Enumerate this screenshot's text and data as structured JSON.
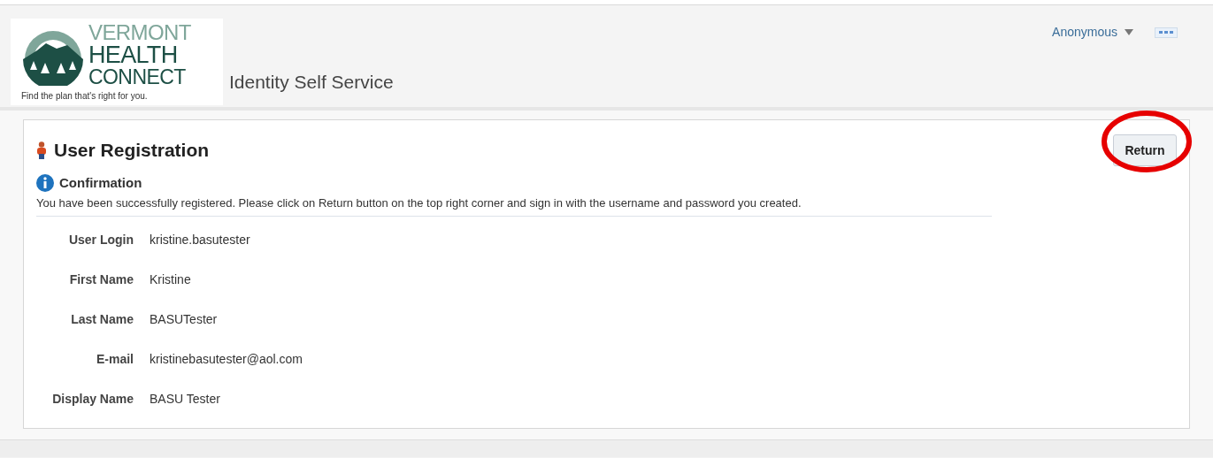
{
  "header": {
    "logo": {
      "lines": [
        "VERMONT",
        "HEALTH",
        "CONNECT"
      ],
      "tagline": "Find the plan that's right for you."
    },
    "app_title": "Identity Self Service",
    "user_menu": "Anonymous"
  },
  "panel": {
    "title": "User Registration",
    "return_button": "Return",
    "confirmation": {
      "title": "Confirmation",
      "message": "You have been successfully registered. Please click on Return button on the top right corner and sign in with the username and password you created."
    },
    "fields": [
      {
        "label": "User Login",
        "value": "kristine.basutester"
      },
      {
        "label": "First Name",
        "value": "Kristine"
      },
      {
        "label": "Last Name",
        "value": "BASUTester"
      },
      {
        "label": "E-mail",
        "value": "kristinebasutester@aol.com"
      },
      {
        "label": "Display Name",
        "value": "BASU Tester"
      }
    ]
  }
}
